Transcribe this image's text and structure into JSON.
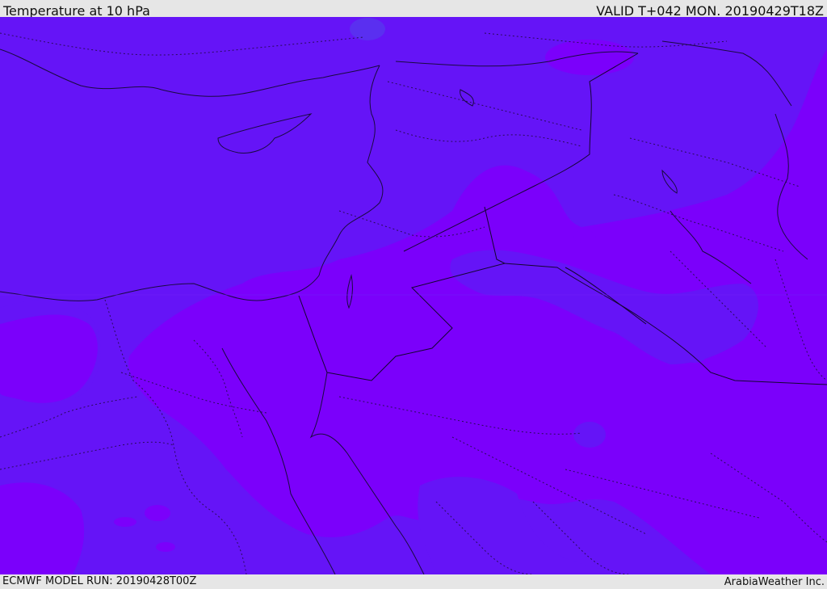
{
  "header": {
    "title": "Temperature at 10 hPa",
    "valid_time": "VALID T+042 MON. 20190429T18Z"
  },
  "footer": {
    "model_run": "ECMWF MODEL RUN: 20190428T00Z",
    "provider": "ArabiaWeather Inc."
  },
  "map": {
    "colors": {
      "band_cooler": "#6514f7",
      "band_warmer": "#7b00fb",
      "band_cold_spot": "#5a2ff0",
      "coastline": "#1a0a40",
      "borders": "#2a0a5a"
    }
  }
}
